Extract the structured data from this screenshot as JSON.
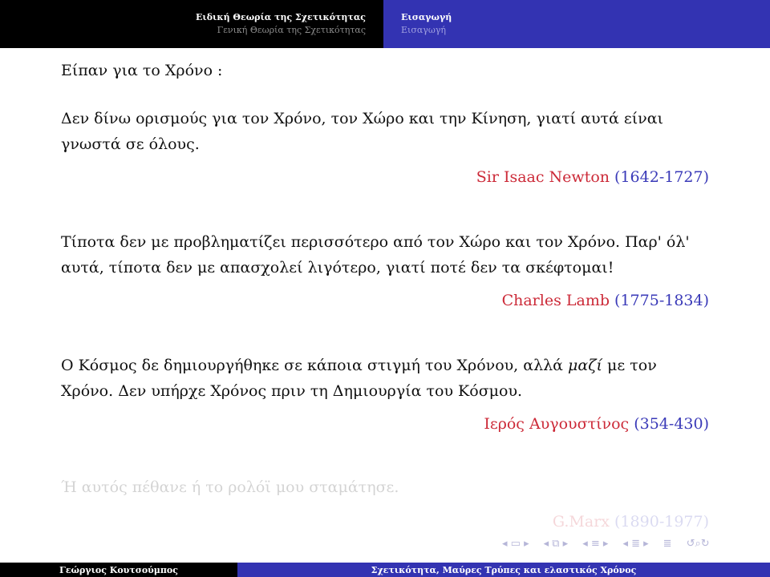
{
  "header": {
    "left": {
      "active": "Ειδική Θεωρία της Σχετικότητας",
      "inactive": "Γενική Θεωρία της Σχετικότητας"
    },
    "right": {
      "active": "Εισαγωγή",
      "inactive": "Εισαγωγή"
    }
  },
  "heading": "Είπαν για το Χρόνο :",
  "quotes": [
    {
      "text": "Δεν δίνω ορισμούς για τον Χρόνο, τον Χώρο και την Κίνηση, γιατί αυτά είναι γνωστά σε όλους.",
      "author": "Sir Isaac Newton",
      "years": "(1642-1727)"
    },
    {
      "text": "Τίποτα δεν με προβληματίζει περισσότερο από τον Χώρο και τον Χρόνο. Παρ' όλ' αυτά, τίποτα δεν με απασχολεί λιγότερο, γιατί ποτέ δεν τα σκέφτομαι!",
      "author": "Charles Lamb",
      "years": "(1775-1834)"
    },
    {
      "text_before": "Ο Κόσμος δε δημιουργήθηκε σε κάποια στιγμή του Χρόνου, αλλά ",
      "text_emph": "μαζί",
      "text_after": " με τον Χρόνο. Δεν υπήρχε Χρόνος πριν τη Δημιουργία του Κόσμου.",
      "author": "Ιερός Αυγουστίνος",
      "years": "(354-430)"
    },
    {
      "text": "Ή αυτός πέθανε ή το ρολόϊ μου σταμάτησε.",
      "author": "G.Marx",
      "years": "(1890-1977)"
    }
  ],
  "nav_icons": [
    "nav-frame-icon",
    "nav-subsection-icon",
    "nav-section-icon",
    "nav-document-icon",
    "nav-appendix-icon",
    "nav-search-icon"
  ],
  "footer": {
    "author": "Γεώργιος Κουτσούμπος",
    "title": "Σχετικότητα, Μαύρες Τρύπες και ελαστικός Χρόνος"
  },
  "colors": {
    "header_dark": "#000000",
    "header_blue": "#3333b2",
    "author": "#cc2a38",
    "years": "#3a3ab8"
  }
}
